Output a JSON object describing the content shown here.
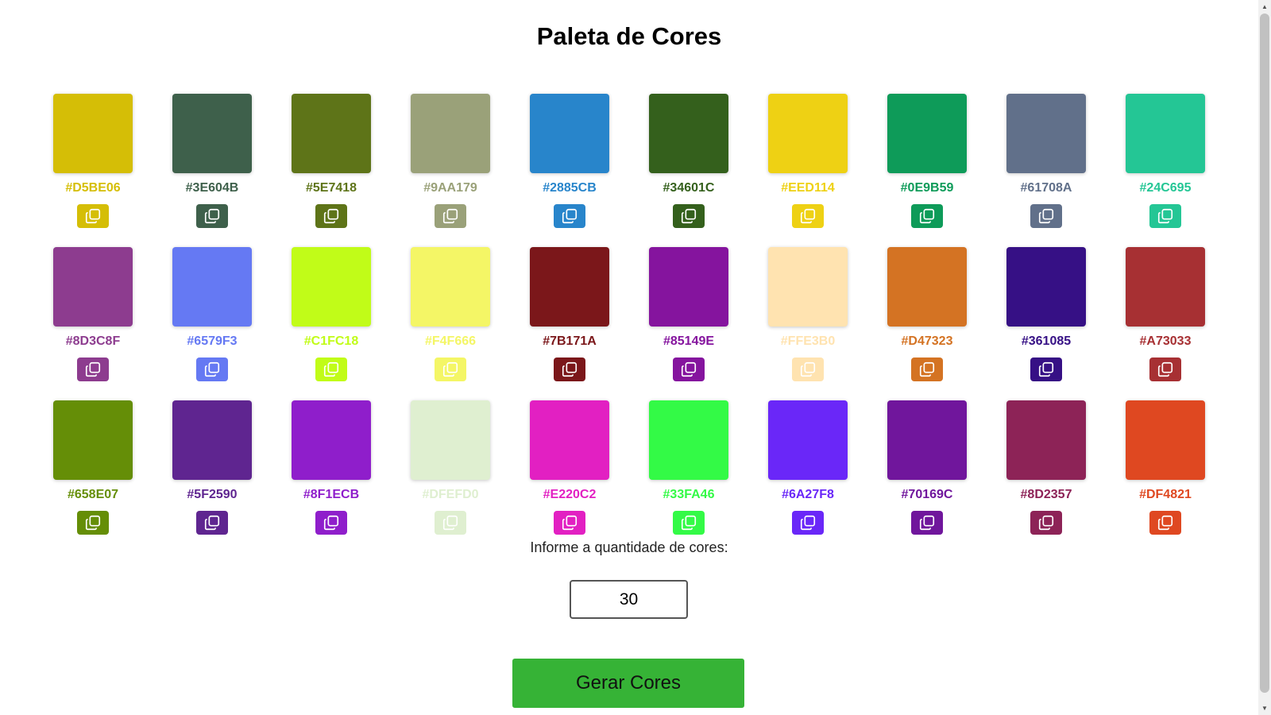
{
  "page": {
    "title": "Paleta de Cores",
    "quantity_label": "Informe a quantidade de cores:",
    "quantity_value": "30",
    "generate_label": "Gerar Cores"
  },
  "copy_icon": "copy-icon",
  "colors": [
    "#D5BE06",
    "#3E604B",
    "#5E7418",
    "#9AA179",
    "#2885CB",
    "#34601C",
    "#EED114",
    "#0E9B59",
    "#61708A",
    "#24C695",
    "#8D3C8F",
    "#6579F3",
    "#C1FC18",
    "#F4F666",
    "#7B171A",
    "#85149E",
    "#FFE3B0",
    "#D47323",
    "#361085",
    "#A73033",
    "#658E07",
    "#5F2590",
    "#8F1ECB",
    "#DFEFD0",
    "#E220C2",
    "#33FA46",
    "#6A27F8",
    "#70169C",
    "#8D2357",
    "#DF4821"
  ],
  "scrollbar": {
    "up_icon": "scroll-up-arrow-icon",
    "down_icon": "scroll-down-arrow-icon"
  }
}
